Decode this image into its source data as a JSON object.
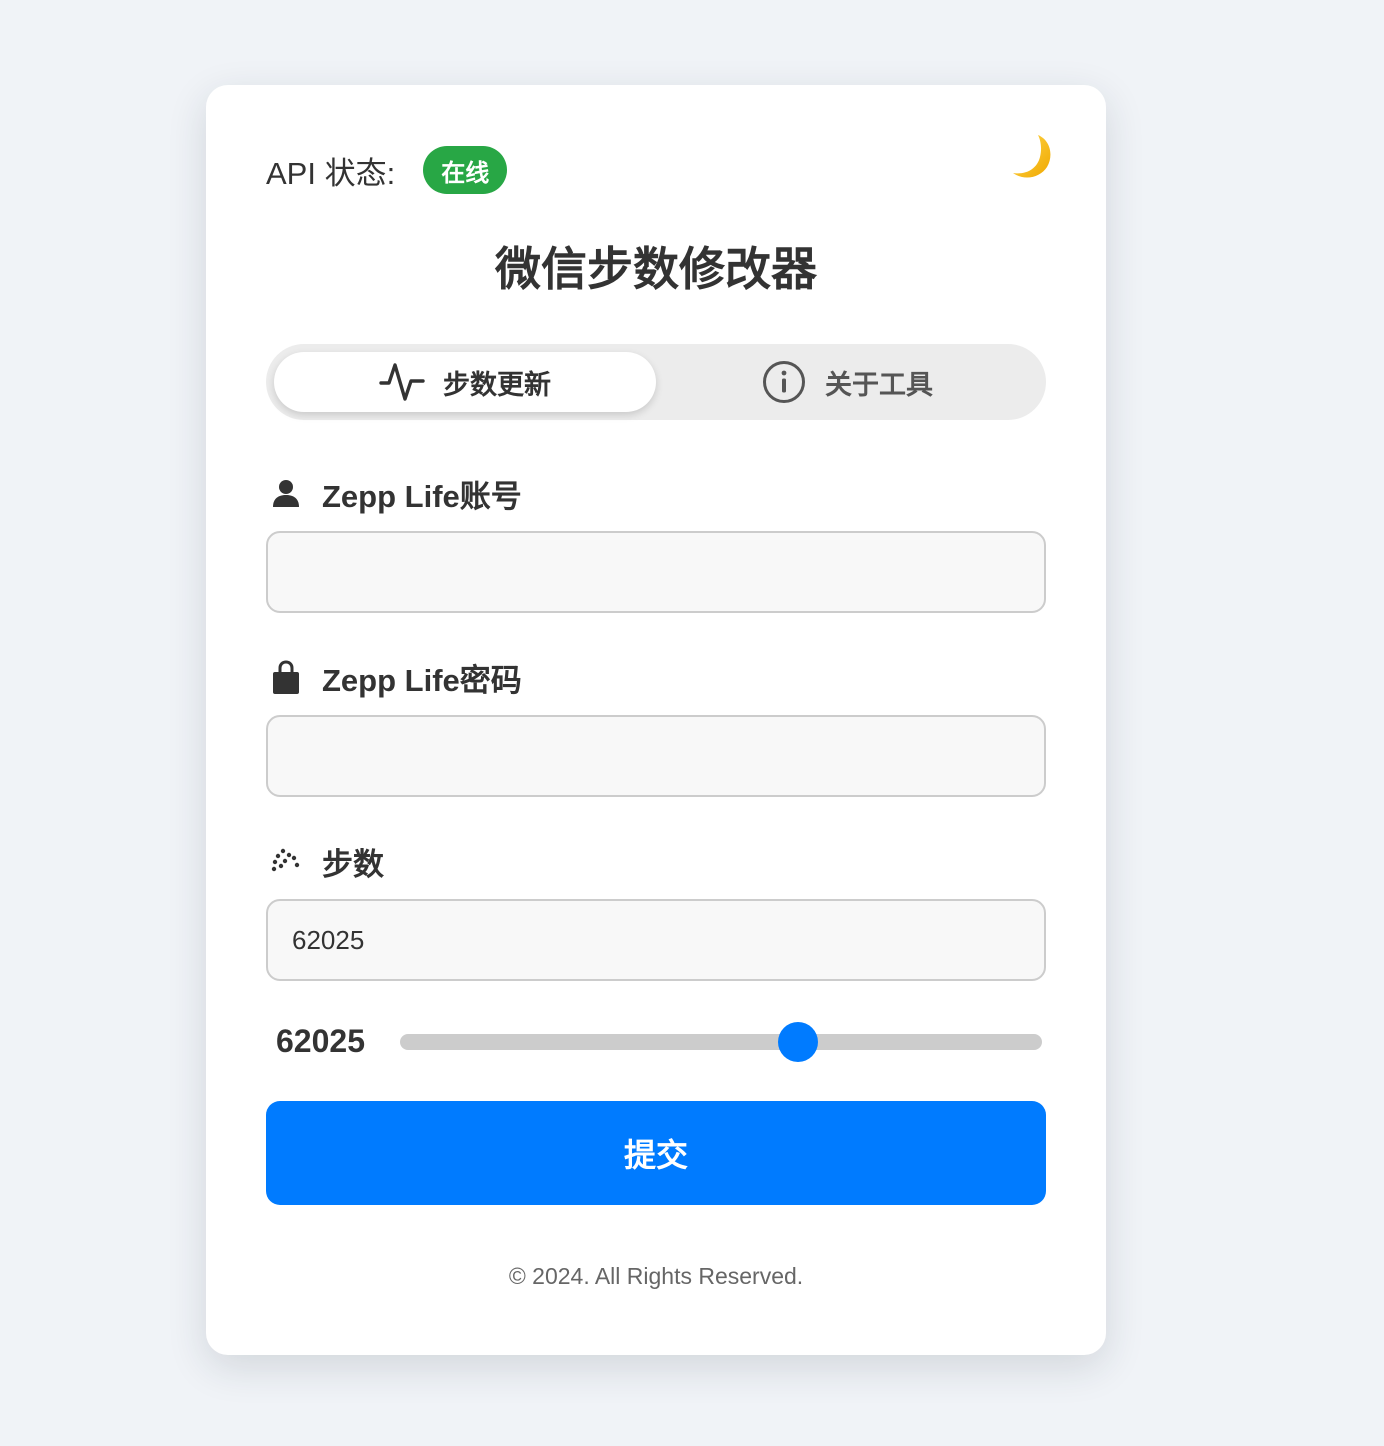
{
  "api": {
    "label": "API 状态:",
    "status": "在线",
    "status_color": "#28a745"
  },
  "theme_toggle_icon": "moon-icon",
  "title": "微信步数修改器",
  "tabs": [
    {
      "label": "步数更新",
      "icon": "activity-pulse-icon",
      "active": true
    },
    {
      "label": "关于工具",
      "icon": "info-circle-icon",
      "active": false
    }
  ],
  "fields": {
    "account": {
      "label": "Zepp Life账号",
      "icon": "user-icon",
      "value": ""
    },
    "password": {
      "label": "Zepp Life密码",
      "icon": "lock-icon",
      "value": ""
    },
    "steps": {
      "label": "步数",
      "icon": "footprints-icon",
      "value": "62025"
    }
  },
  "slider": {
    "value": "62025",
    "fraction": 0.62
  },
  "submit_label": "提交",
  "accent_color": "#007bff",
  "footer": "© 2024. All Rights Reserved."
}
